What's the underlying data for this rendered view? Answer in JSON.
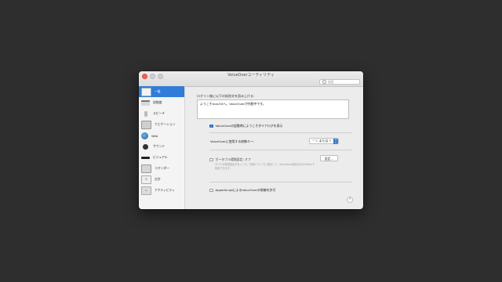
{
  "window": {
    "title": "VoiceOverユーティリティ"
  },
  "search": {
    "placeholder": "検索"
  },
  "sidebar": {
    "items": [
      {
        "label": "一般",
        "icon": "general-icon",
        "selected": true
      },
      {
        "label": "詳細度",
        "icon": "verbosity-icon"
      },
      {
        "label": "スピーチ",
        "icon": "speech-icon"
      },
      {
        "label": "ナビゲーション",
        "icon": "navigation-icon"
      },
      {
        "label": "Web",
        "icon": "web-icon"
      },
      {
        "label": "サウンド",
        "icon": "sound-icon"
      },
      {
        "label": "ビジュアル",
        "icon": "visual-icon"
      },
      {
        "label": "コマンダー",
        "icon": "commanders-icon"
      },
      {
        "label": "点字",
        "icon": "braille-icon"
      },
      {
        "label": "アクティビティ",
        "icon": "activities-icon"
      }
    ]
  },
  "general": {
    "welcome_label": "ログイン後に以下の挨拶文を読み上げる:",
    "welcome_text": "ようこそmacOSへ。VoiceOverが作動中です。",
    "show_welcome_dialog_label": "VoiceOverの起動時にようこそダイアログを表示",
    "show_welcome_dialog_checked": true,
    "modifier_label": "VoiceOverに使用する修飾キー:",
    "modifier_value": "^⌥ または ⇪",
    "portable_label": "ポータブル環境設定: オフ",
    "portable_checked": false,
    "setup_button": "設定...",
    "portable_description": "すべての環境設定がなくとも、外部ドライブに保存して、VoiceOver設定をほかのMacで利用できます。",
    "applescript_label": "AppleScriptによるVoiceOverの制御を許可",
    "applescript_checked": false,
    "help_label": "?"
  },
  "colors": {
    "accent": "#2f7dd8",
    "desktop": "#2e2e2e",
    "close": "#fc5f57"
  }
}
